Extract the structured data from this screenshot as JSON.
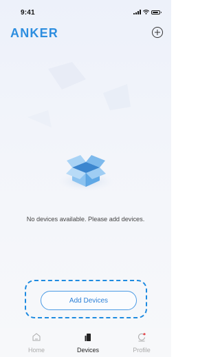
{
  "status_bar": {
    "time": "9:41"
  },
  "header": {
    "logo": "ANKER",
    "brand_color": "#2d8edf",
    "add_icon": "circle-plus-icon"
  },
  "empty_state": {
    "illustration": "open-box-icon",
    "message": "No devices available. Please add devices."
  },
  "actions": {
    "add_devices_label": "Add Devices",
    "highlight_color": "#1d8ae0"
  },
  "tab_bar": {
    "tabs": [
      {
        "label": "Home",
        "icon": "home-icon",
        "active": false
      },
      {
        "label": "Devices",
        "icon": "devices-icon",
        "active": true
      },
      {
        "label": "Profile",
        "icon": "profile-icon",
        "active": false
      }
    ],
    "profile_badge_color": "#e5484d"
  }
}
